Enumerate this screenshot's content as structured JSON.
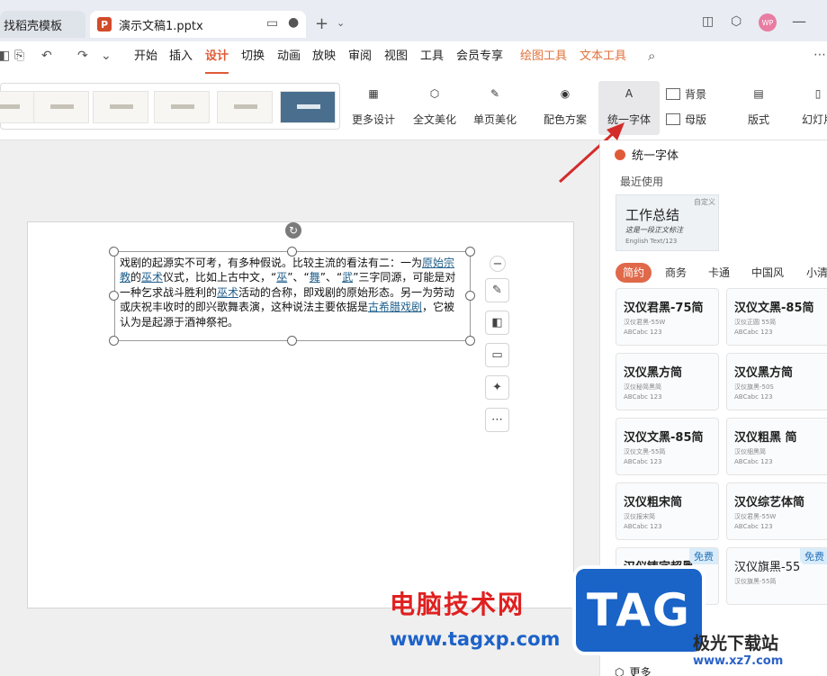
{
  "tabs": {
    "template_tab": "找稻壳模板",
    "doc_tab": "演示文稿1.pptx",
    "new_tab": "+"
  },
  "menus": [
    "开始",
    "插入",
    "设计",
    "切换",
    "动画",
    "放映",
    "审阅",
    "视图",
    "工具",
    "会员专享",
    "绘图工具",
    "文本工具"
  ],
  "ribbon": {
    "more_design": "更多设计",
    "beautify_all": "全文美化",
    "beautify_page": "单页美化",
    "color_scheme": "配色方案",
    "unify_font": "统一字体",
    "background": "背景",
    "master": "母版",
    "layout": "版式",
    "slide_size": "幻灯片"
  },
  "slide": {
    "para1": "戏剧的起源实不可考，有多种假说。比较主流的看法有二：一为",
    "link1": "原始宗教",
    "para2": "的",
    "link2": "巫术",
    "para3": "仪式，比如上古中文，“",
    "link3": "巫",
    "para4": "”、“",
    "link4": "舞",
    "para5": "”、“",
    "link5": "武",
    "para6": "”三字同源，可能是对一种乞求战斗胜利的",
    "link6": "巫术",
    "para7": "活动的合称，即戏剧的原始形态。另一为劳动或庆祝丰收时的即兴歌舞表演，这种说法主要依据是",
    "link7": "古希腊戏剧",
    "para8": "，它被认为是起源于酒神祭祀。"
  },
  "panel": {
    "title": "统一字体",
    "recent_label": "最近使用",
    "custom_card": {
      "title": "工作总结",
      "subtitle": "这是一段正文标注",
      "sample": "English Text/123",
      "badge": "自定义"
    },
    "categories": [
      "简约",
      "商务",
      "卡通",
      "中国风",
      "小清"
    ],
    "fonts": [
      {
        "name": "汉仪君黑-75简",
        "sub": "汉仪君黑-55W",
        "abc": "ABCabc 123"
      },
      {
        "name": "汉仪文黑-85简",
        "sub": "汉仪正圆 55简",
        "abc": "ABCabc 123"
      },
      {
        "name": "汉仪黑方简",
        "sub": "汉仪秘简黑简",
        "abc": "ABCabc 123"
      },
      {
        "name": "汉仪黑方简",
        "sub": "汉仪旗黑-50S",
        "abc": "ABCabc 123"
      },
      {
        "name": "汉仪文黑-85简",
        "sub": "汉仪文黑-55简",
        "abc": "ABCabc 123"
      },
      {
        "name": "汉仪粗黑 简",
        "sub": "汉仪细黑简",
        "abc": "ABCabc 123"
      },
      {
        "name": "汉仪粗宋简",
        "sub": "汉仪报宋简",
        "abc": "ABCabc 123"
      },
      {
        "name": "汉仪综艺体简",
        "sub": "汉仪君黑-55W",
        "abc": "ABCabc 123"
      },
      {
        "name": "汉仪铸字超黑",
        "sub": "",
        "abc": "",
        "free": "免费"
      },
      {
        "name": "汉仪旗黑-55",
        "sub": "汉仪旗黑-55简",
        "abc": "",
        "free": "免费"
      }
    ],
    "more_label": "更多"
  },
  "watermark": {
    "site_cn": "电脑技术网",
    "site_url": "www.tagxp.com",
    "tag": "TAG",
    "brand": "极光下载站",
    "brand_url": "www.xz7.com"
  }
}
